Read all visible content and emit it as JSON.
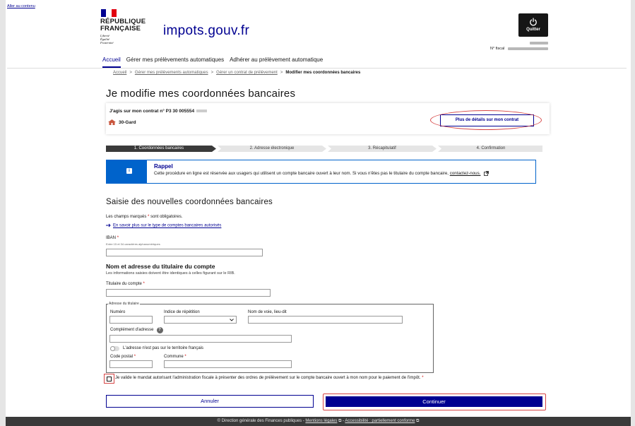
{
  "skip_link": "Aller au contenu",
  "header": {
    "marianne_line1": "RÉPUBLIQUE",
    "marianne_line2": "FRANÇAISE",
    "devise1": "Liberté",
    "devise2": "Égalité",
    "devise3": "Fraternité",
    "site_name": "impots.gouv.fr",
    "quit_label": "Quitter",
    "nfiscal_label": "N° fiscal"
  },
  "nav": {
    "items": [
      "Accueil",
      "Gérer mes prélèvements automatiques",
      "Adhérer au prélèvement automatique"
    ]
  },
  "breadcrumb": {
    "items": [
      "Accueil",
      "Gérer mes prélèvements automatiques",
      "Gérer un contrat de prélèvement"
    ],
    "current": "Modifier mes coordonnées bancaires",
    "separator": ">"
  },
  "page_title": "Je modifie mes coordonnées bancaires",
  "contract": {
    "title": "J'agis sur mon contrat n° P3 30 005554",
    "department": "30-Gard",
    "details_button": "Plus de détails sur mon contrat"
  },
  "steps": [
    "1. Coordonnées bancaires",
    "2. Adresse électronique",
    "3. Récapitulatif",
    "4. Confirmation"
  ],
  "rappel": {
    "title": "Rappel",
    "body": "Cette procédure en ligne est réservée aux usagers qui utilisent un compte bancaire ouvert à leur nom. Si vous n'êtes pas le titulaire du compte bancaire,",
    "link": "contactez-nous."
  },
  "form": {
    "section_title": "Saisie des nouvelles coordonnées bancaires",
    "mandatory_prefix": "Les champs marqués",
    "mandatory_star": "*",
    "mandatory_suffix": "sont obligatoires.",
    "learn_more": "En savoir plus sur le type de comptes bancaires autorisés",
    "iban_label": "IBAN",
    "iban_hint": "Entre 15 et 34 caractères alphanumériques",
    "holder_section_title": "Nom et adresse du titulaire du compte",
    "holder_section_sub": "Les informations saisies doivent être identiques à celles figurant sur le RIB.",
    "holder_label": "Titulaire du compte",
    "address_legend": "Adresse du titulaire",
    "numero_label": "Numéro",
    "repetition_label": "Indice de répétition",
    "voie_label": "Nom de voie, lieu-dit",
    "complement_label": "Complément d'adresse",
    "foreign_toggle_label": "L'adresse n'est pas sur le territoire français",
    "cp_label": "Code postal",
    "commune_label": "Commune",
    "mandate_text": "Je valide le mandat autorisant l'administration fiscale à présenter des ordres de prélèvement sur le compte bancaire ouvert à mon nom pour le paiement de l'impôt."
  },
  "buttons": {
    "cancel": "Annuler",
    "continue": "Continuer"
  },
  "footer": {
    "copyright": "© Direction générale des Finances publiques -",
    "legal": "Mentions légales",
    "sep": "-",
    "accessibility": "Accessibilité : partiellement conforme"
  },
  "colors": {
    "primary": "#000091",
    "flag_blue": "#000091",
    "flag_red": "#e1000f",
    "info_blue": "#0063cb",
    "annotation_red": "#d64545",
    "footer_bg": "#3a3a3a"
  }
}
